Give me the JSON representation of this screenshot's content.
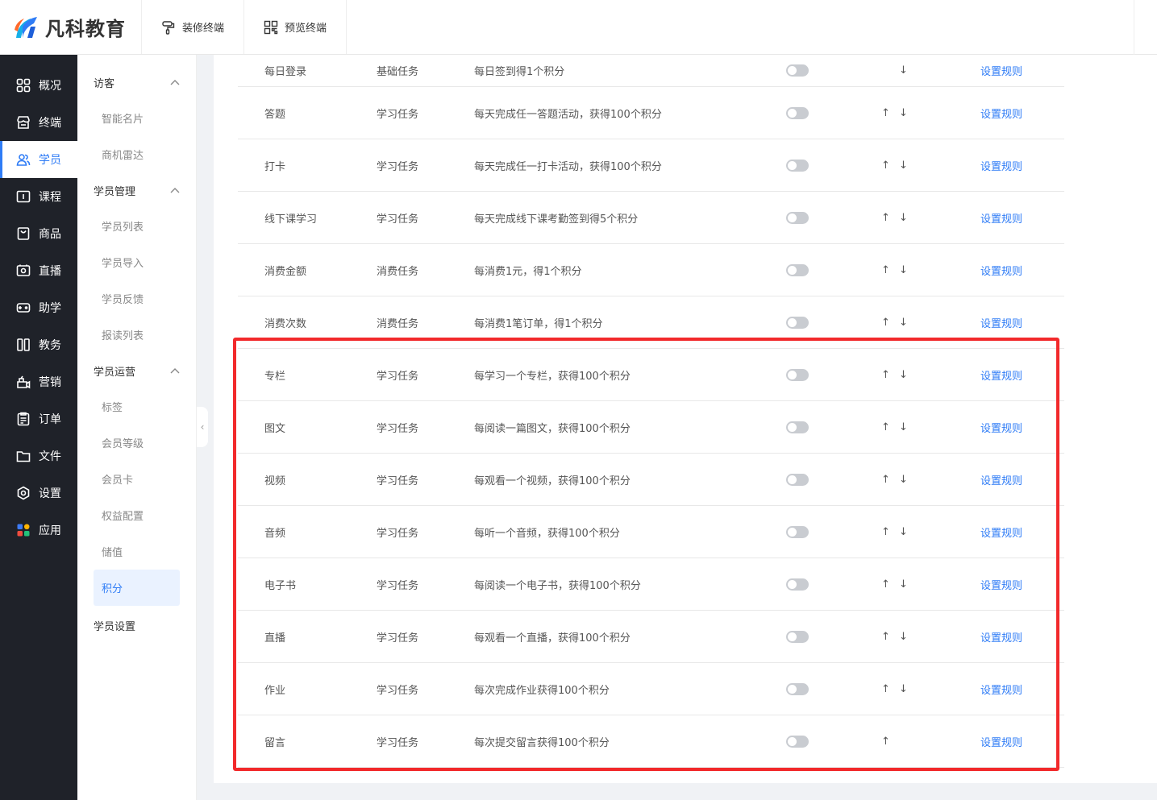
{
  "brand": {
    "name": "凡科教育"
  },
  "topbar": {
    "decorate_label": "装修终端",
    "preview_label": "预览终端"
  },
  "sidebar": {
    "items": [
      {
        "label": "概况",
        "icon": "grid-icon"
      },
      {
        "label": "终端",
        "icon": "store-icon"
      },
      {
        "label": "学员",
        "icon": "users-icon",
        "active": true
      },
      {
        "label": "课程",
        "icon": "course-icon"
      },
      {
        "label": "商品",
        "icon": "bag-icon"
      },
      {
        "label": "直播",
        "icon": "live-icon"
      },
      {
        "label": "助学",
        "icon": "gamepad-icon"
      },
      {
        "label": "教务",
        "icon": "columns-icon"
      },
      {
        "label": "营销",
        "icon": "marketing-icon"
      },
      {
        "label": "订单",
        "icon": "order-icon"
      },
      {
        "label": "文件",
        "icon": "folder-icon"
      },
      {
        "label": "设置",
        "icon": "settings-icon"
      },
      {
        "label": "应用",
        "icon": "apps-icon"
      }
    ]
  },
  "submenu": {
    "groups": [
      {
        "label": "访客",
        "items": [
          "智能名片",
          "商机雷达"
        ]
      },
      {
        "label": "学员管理",
        "items": [
          "学员列表",
          "学员导入",
          "学员反馈",
          "报读列表"
        ]
      },
      {
        "label": "学员运营",
        "items": [
          "标签",
          "会员等级",
          "会员卡",
          "权益配置",
          "储值",
          "积分"
        ]
      }
    ],
    "active_item": "积分",
    "settings_label": "学员设置"
  },
  "table": {
    "link_label": "设置规则",
    "up_arrow": "↑",
    "down_arrow": "↓",
    "rows": [
      {
        "name": "每日登录",
        "type": "基础任务",
        "desc": "每日签到得1个积分",
        "up": false,
        "down": true
      },
      {
        "name": "答题",
        "type": "学习任务",
        "desc": "每天完成任一答题活动，获得100个积分",
        "up": true,
        "down": true
      },
      {
        "name": "打卡",
        "type": "学习任务",
        "desc": "每天完成任一打卡活动，获得100个积分",
        "up": true,
        "down": true
      },
      {
        "name": "线下课学习",
        "type": "学习任务",
        "desc": "每天完成线下课考勤签到得5个积分",
        "up": true,
        "down": true
      },
      {
        "name": "消费金额",
        "type": "消费任务",
        "desc": "每消费1元，得1个积分",
        "up": true,
        "down": true
      },
      {
        "name": "消费次数",
        "type": "消费任务",
        "desc": "每消费1笔订单，得1个积分",
        "up": true,
        "down": true
      },
      {
        "name": "专栏",
        "type": "学习任务",
        "desc": "每学习一个专栏，获得100个积分",
        "up": true,
        "down": true
      },
      {
        "name": "图文",
        "type": "学习任务",
        "desc": "每阅读一篇图文，获得100个积分",
        "up": true,
        "down": true
      },
      {
        "name": "视频",
        "type": "学习任务",
        "desc": "每观看一个视频，获得100个积分",
        "up": true,
        "down": true
      },
      {
        "name": "音频",
        "type": "学习任务",
        "desc": "每听一个音频，获得100个积分",
        "up": true,
        "down": true
      },
      {
        "name": "电子书",
        "type": "学习任务",
        "desc": "每阅读一个电子书，获得100个积分",
        "up": true,
        "down": true
      },
      {
        "name": "直播",
        "type": "学习任务",
        "desc": "每观看一个直播，获得100个积分",
        "up": true,
        "down": true
      },
      {
        "name": "作业",
        "type": "学习任务",
        "desc": "每次完成作业获得100个积分",
        "up": true,
        "down": true
      },
      {
        "name": "留言",
        "type": "学习任务",
        "desc": "每次提交留言获得100个积分",
        "up": true,
        "down": false
      }
    ]
  },
  "colors": {
    "accent": "#2f7cf6",
    "highlight": "#f2292b",
    "sidebar_bg": "#1f2229"
  }
}
